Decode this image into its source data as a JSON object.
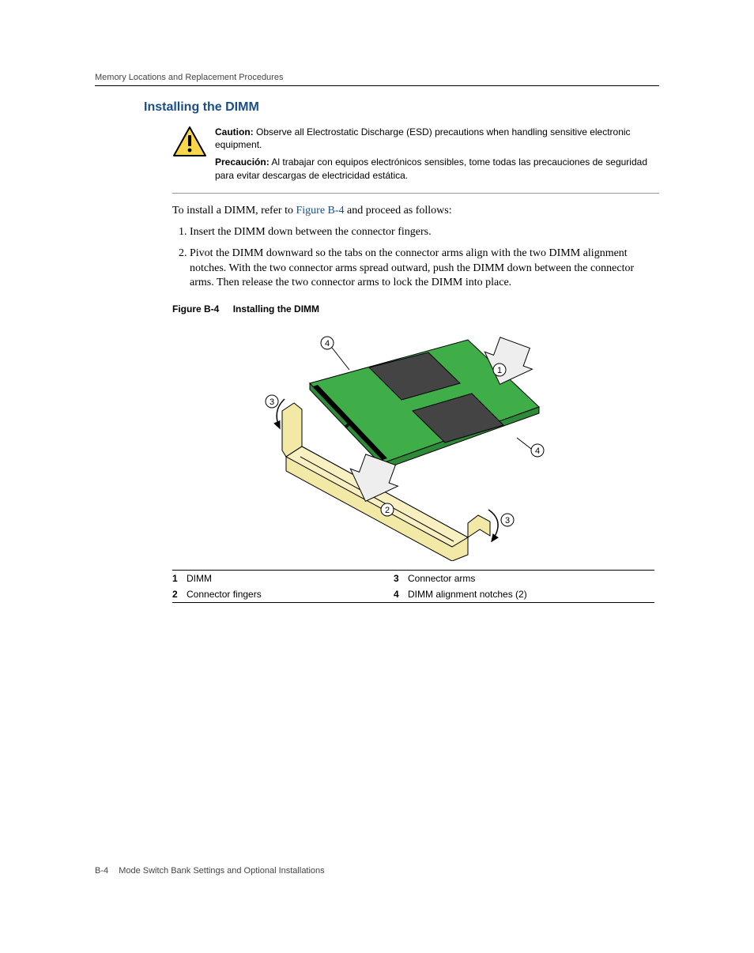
{
  "header": {
    "runningTitle": "Memory Locations and Replacement Procedures"
  },
  "section": {
    "title": "Installing the DIMM"
  },
  "caution": {
    "label_en": "Caution:",
    "text_en": "Observe all Electrostatic Discharge (ESD) precautions when handling sensitive electronic equipment.",
    "label_es": "Precaución:",
    "text_es": "Al trabajar con equipos electrónicos sensibles, tome todas las precauciones de seguridad para evitar descargas de electricidad estática."
  },
  "intro": {
    "pre": "To install a DIMM, refer to ",
    "link": "Figure B-4",
    "post": " and proceed as follows:"
  },
  "steps": [
    "Insert the DIMM down between the connector fingers.",
    "Pivot the DIMM downward so the tabs on the connector arms align with the two DIMM alignment notches. With the two connector arms spread outward, push the DIMM down between the connector arms. Then release the two connector arms to lock the DIMM into place."
  ],
  "figure": {
    "number": "Figure B-4",
    "title": "Installing the DIMM",
    "callouts": [
      "1",
      "2",
      "3",
      "4"
    ]
  },
  "legend": [
    {
      "n": "1",
      "t": "DIMM"
    },
    {
      "n": "2",
      "t": "Connector fingers"
    },
    {
      "n": "3",
      "t": "Connector arms"
    },
    {
      "n": "4",
      "t": "DIMM alignment notches (2)"
    }
  ],
  "footer": {
    "pagenum": "B-4",
    "title": "Mode Switch Bank Settings and Optional Installations"
  }
}
